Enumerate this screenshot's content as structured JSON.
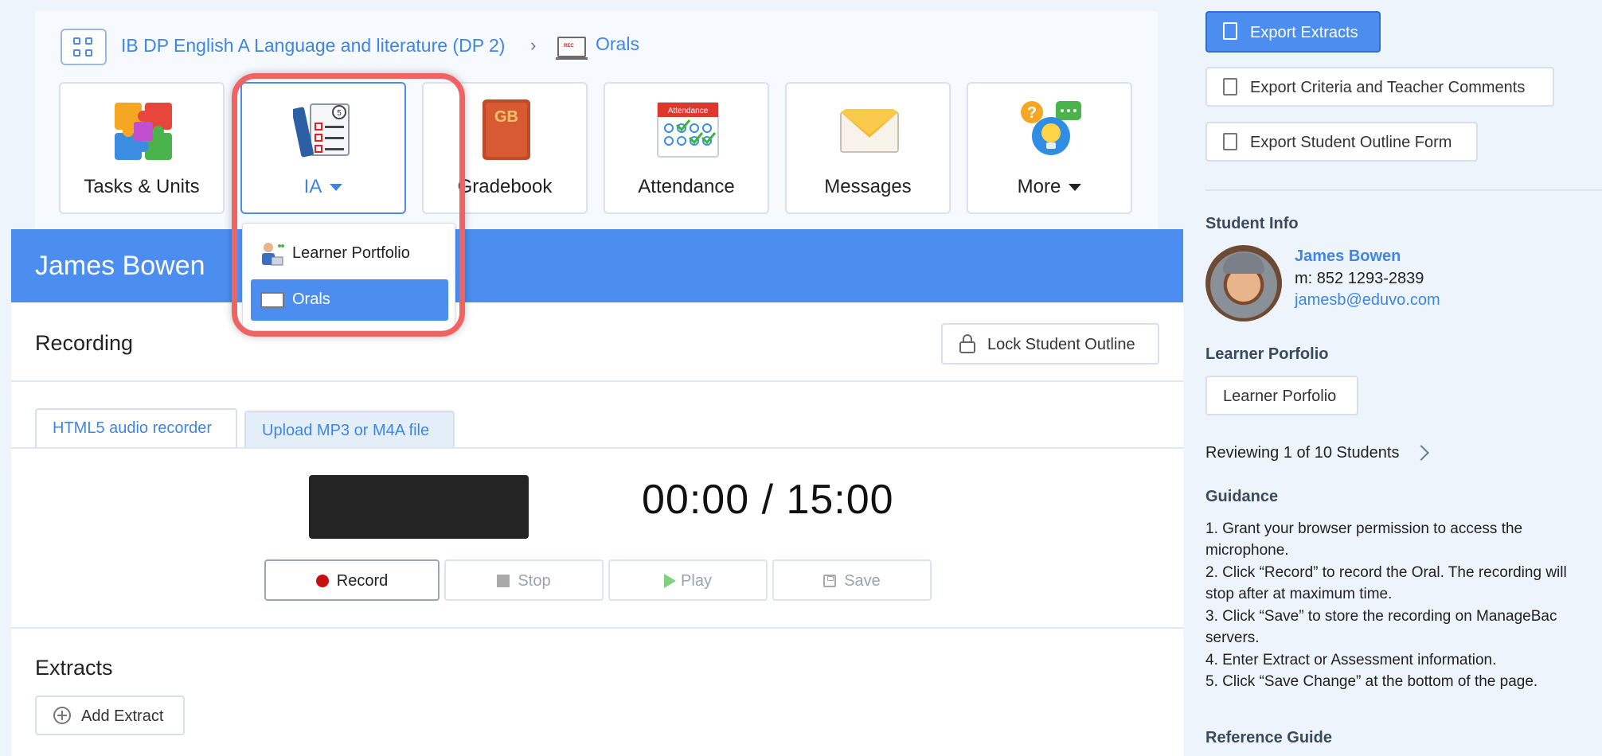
{
  "breadcrumb": {
    "class_name": "IB DP English A Language and literature (DP 2)",
    "current": "Orals",
    "rec_label": "REC"
  },
  "nav_tiles": [
    {
      "label": "Tasks & Units"
    },
    {
      "label": "IA"
    },
    {
      "label": "Gradebook"
    },
    {
      "label": "Attendance"
    },
    {
      "label": "Messages"
    },
    {
      "label": "More"
    }
  ],
  "gradebook_icon_text": "GB",
  "attendance_icon_text": "Attendance",
  "ia_badge": "5",
  "dropdown": {
    "items": [
      {
        "label": "Learner Portfolio"
      },
      {
        "label": "Orals"
      }
    ]
  },
  "student": {
    "name": "James Bowen",
    "phone": "m: 852 1293-2839",
    "email": "jamesb@eduvo.com"
  },
  "recording": {
    "title": "Recording",
    "lock_label": "Lock Student Outline",
    "tabs": [
      {
        "label": "HTML5 audio recorder"
      },
      {
        "label": "Upload MP3 or M4A file"
      }
    ],
    "timer": "00:00 / 15:00",
    "controls": {
      "record": "Record",
      "stop": "Stop",
      "play": "Play",
      "save": "Save"
    }
  },
  "extracts": {
    "title": "Extracts",
    "add_label": "Add Extract"
  },
  "sidebar": {
    "export_extracts": "Export Extracts",
    "export_criteria": "Export Criteria and Teacher Comments",
    "export_outline": "Export Student Outline Form",
    "student_info_heading": "Student Info",
    "learner_heading": "Learner Porfolio",
    "learner_button": "Learner Porfolio",
    "reviewing": "Reviewing 1 of 10 Students",
    "guidance_heading": "Guidance",
    "guidance": [
      "1. Grant your browser permission to access the microphone.",
      "2. Click “Record” to record the Oral. The recording will stop after at maximum time.",
      "3. Click “Save” to store the recording on ManageBac servers.",
      "4. Enter Extract or Assessment information.",
      "5. Click “Save Change” at the bottom of the page."
    ],
    "reference_heading": "Reference Guide"
  },
  "colors": {
    "accent": "#4c8ef0",
    "link": "#3f86e4",
    "highlight": "#f06363",
    "record_dot": "#c80f0f"
  }
}
